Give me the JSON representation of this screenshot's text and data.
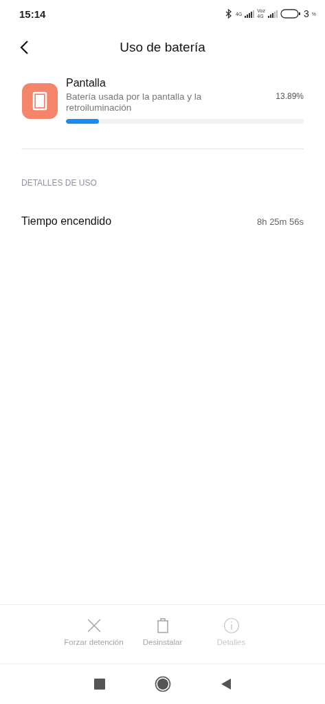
{
  "status_bar": {
    "time": "15:14",
    "sim_1": "4G",
    "sim_2_top": "Voz",
    "sim_2_bottom": "4G",
    "battery": "3",
    "battery_unit": "%"
  },
  "header": {
    "title": "Uso de batería"
  },
  "app": {
    "name": "Pantalla",
    "description": "Batería usada por la pantalla y la retroiluminación",
    "percent": "13.89%",
    "level": 0.1389
  },
  "section": {
    "title": "DETALLES DE USO"
  },
  "details": [
    {
      "label": "Tiempo encendido",
      "value": "8h 25m 56s"
    }
  ],
  "actions": [
    {
      "kind": "stop",
      "label": "Forzar detención",
      "disabled": false
    },
    {
      "kind": "uninstall",
      "label": "Desinstalar",
      "disabled": false
    },
    {
      "kind": "info",
      "label": "Detalles",
      "disabled": true
    }
  ]
}
